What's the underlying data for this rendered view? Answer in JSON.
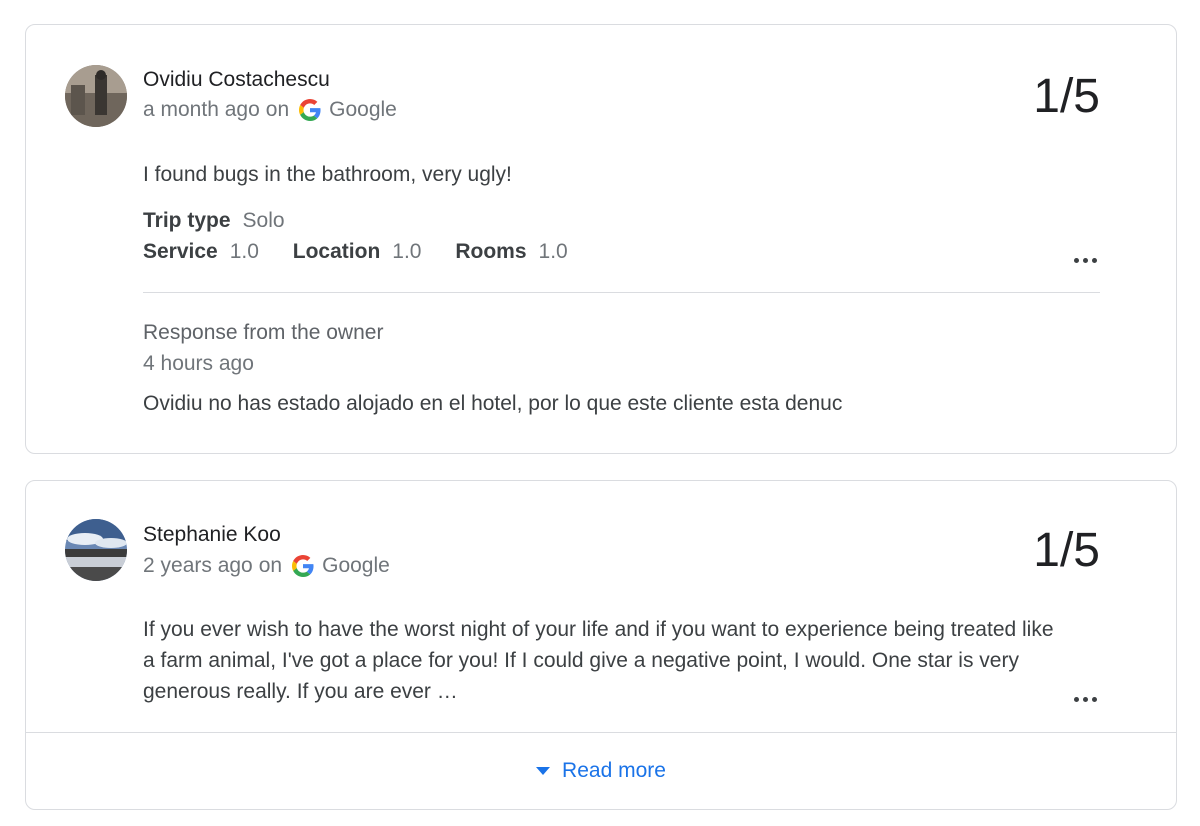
{
  "reviews": [
    {
      "author": "Ovidiu Costachescu",
      "time": "a month ago",
      "on_label": "on",
      "source": "Google",
      "rating": "1/5",
      "text": "I found bugs in the bathroom, very ugly!",
      "trip_type_label": "Trip type",
      "trip_type_value": "Solo",
      "scores": [
        {
          "label": "Service",
          "value": "1.0"
        },
        {
          "label": "Location",
          "value": "1.0"
        },
        {
          "label": "Rooms",
          "value": "1.0"
        }
      ],
      "owner_response": {
        "title": "Response from the owner",
        "time": "4 hours ago",
        "text": "Ovidiu no has estado alojado en el hotel, por lo que este cliente esta denuc"
      },
      "more_icon": "more-horizontal-icon"
    },
    {
      "author": "Stephanie Koo",
      "time": "2 years ago",
      "on_label": "on",
      "source": "Google",
      "rating": "1/5",
      "text": "If you ever wish to have the worst night of your life and if you want to experience being treated like a farm animal, I've got a place for you! If I could give a negative point, I would. One star is very generous really. If you are ever …",
      "more_icon": "more-horizontal-icon",
      "read_more_label": "Read more"
    }
  ],
  "colors": {
    "link_blue": "#1a73e8",
    "border": "#dadce0",
    "text_primary": "#202124",
    "text_secondary": "#70757a"
  }
}
